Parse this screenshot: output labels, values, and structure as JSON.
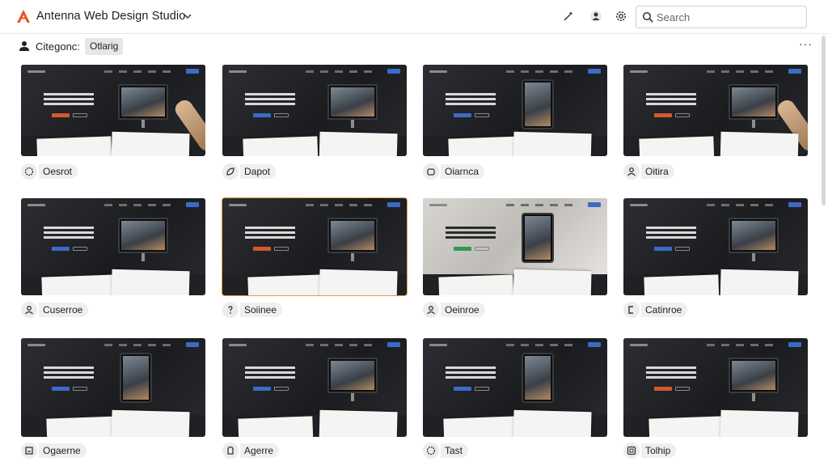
{
  "header": {
    "app_title": "Antenna Web Design Studio",
    "icons": [
      "wand-icon",
      "person-icon",
      "settings-icon"
    ],
    "search": {
      "placeholder": "Search",
      "value": ""
    }
  },
  "filter": {
    "label": "Citegonc:",
    "chip": "Otlarig",
    "more": "···"
  },
  "cards": [
    {
      "label": "Oesrot",
      "icon": "badge-icon"
    },
    {
      "label": "Dapot",
      "icon": "leaf-icon"
    },
    {
      "label": "Oiarnca",
      "icon": "cup-icon"
    },
    {
      "label": "Oitira",
      "icon": "person-icon"
    },
    {
      "label": "Cuserroe",
      "icon": "person-icon"
    },
    {
      "label": "Soiinee",
      "icon": "question-icon"
    },
    {
      "label": "Oeinroe",
      "icon": "person-icon"
    },
    {
      "label": "Catinroe",
      "icon": "bracket-icon"
    },
    {
      "label": "Ogaerne",
      "icon": "square-icon"
    },
    {
      "label": "Agerre",
      "icon": "pin-icon"
    },
    {
      "label": "Tast",
      "icon": "badge-icon"
    },
    {
      "label": "Tolhip",
      "icon": "frame-icon"
    }
  ],
  "colors": {
    "accent": "#e8542a",
    "cta_blue": "#3b6cc5",
    "cta_orange": "#d4582e",
    "cta_green": "#2f9b58"
  }
}
